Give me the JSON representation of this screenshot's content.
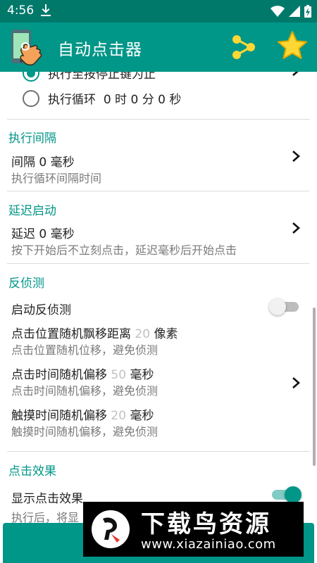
{
  "status_bar": {
    "time": "4:56",
    "icons": [
      "download-icon",
      "wifi-icon",
      "signal-icon",
      "battery-charging-icon"
    ]
  },
  "app_bar": {
    "title": "自动点击器",
    "icons": [
      "app-logo-icon",
      "share-icon",
      "star-icon"
    ]
  },
  "repeat_options": {
    "option_stop": "执行至按停止键为止",
    "option_loop_label": "执行循环",
    "loop_hours": "0",
    "unit_hour": "时",
    "loop_minutes": "0",
    "unit_minute": "分",
    "loop_seconds": "0",
    "unit_second": "秒"
  },
  "interval": {
    "header": "执行间隔",
    "title": "间隔 0 毫秒",
    "subtitle": "执行循环间隔时间"
  },
  "delay": {
    "header": "延迟启动",
    "title": "延迟 0 毫秒",
    "subtitle": "按下开始后不立刻点击，延迟毫秒后开始点击"
  },
  "anti_detect": {
    "header": "反侦测",
    "enable_label": "启动反侦测",
    "enabled": false,
    "position": {
      "label": "点击位置随机飘移距离",
      "value": "20",
      "unit": "像素",
      "subtitle": "点击位置随机位移，避免侦测"
    },
    "click_time": {
      "label": "点击时间随机偏移",
      "value": "50",
      "unit": "毫秒",
      "subtitle": "点击时间随机偏移，避免侦测"
    },
    "touch_time": {
      "label": "触摸时间随机偏移",
      "value": "20",
      "unit": "毫秒",
      "subtitle": "触摸时间随机偏移，避免侦测"
    }
  },
  "click_effect": {
    "header": "点击效果",
    "show_label": "显示点击效果",
    "enabled": true,
    "subtitle": "执行后，将显"
  },
  "watermark": {
    "title": "下载鸟资源",
    "url": "www.xiazainiao.com"
  },
  "colors": {
    "primary": "#009688",
    "primary_dark": "#00796b",
    "accent_yellow": "#fdd835"
  }
}
